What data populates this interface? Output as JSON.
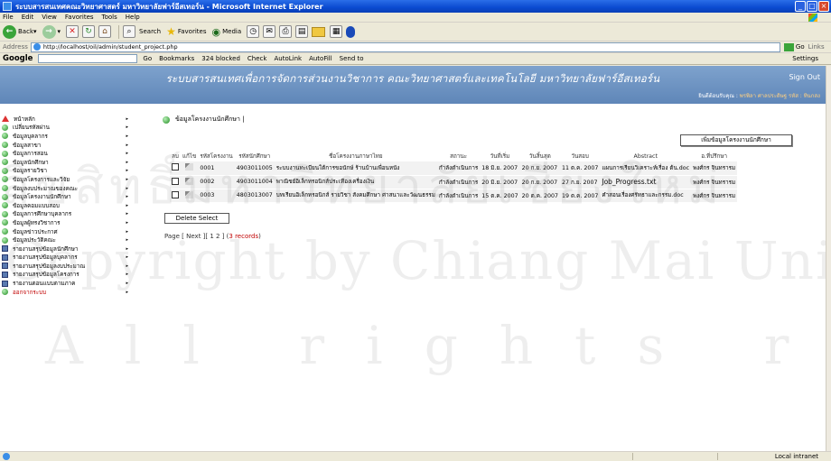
{
  "window": {
    "title": "ระบบสารสนเทศคณะวิทยาศาสตร์ มหาวิทยาลัยฟาร์อีสเทอร์น - Microsoft Internet Explorer"
  },
  "menu": [
    "File",
    "Edit",
    "View",
    "Favorites",
    "Tools",
    "Help"
  ],
  "toolbar": {
    "back": "Back",
    "search": "Search",
    "favorites": "Favorites",
    "media": "Media"
  },
  "address": {
    "label": "Address",
    "url": "http://localhost/oil/admin/student_project.php",
    "go": "Go",
    "links": "Links"
  },
  "googlebar": {
    "logo": "Google",
    "go": "Go",
    "bookmarks": "Bookmarks",
    "blocked": "324 blocked",
    "check": "Check",
    "autolink": "AutoLink",
    "autofill": "AutoFill",
    "sendto": "Send to",
    "settings": "Settings"
  },
  "header": {
    "title": "ระบบสารสนเทศเพื่อการจัดการส่วนงานวิชาการ คณะวิทยาศาสตร์และเทคโนโลยี มหาวิทยาลัยฟาร์อีสเทอร์น",
    "signout": "Sign Out",
    "welcome_prefix": "ยินดีต้อนรับคุณ :",
    "welcome_user": "พรพิลา ศาลประดิษฐ รหัส : ทินกสง"
  },
  "sidebar": {
    "items": [
      {
        "label": "หน้าหลัก",
        "icon": "home"
      },
      {
        "label": "เปลี่ยนรหัสผ่าน",
        "icon": "dot"
      },
      {
        "label": "ข้อมูลบุคลากร",
        "icon": "dot"
      },
      {
        "label": "ข้อมูลสาขา",
        "icon": "dot"
      },
      {
        "label": "ข้อมูลการสอน",
        "icon": "dot"
      },
      {
        "label": "ข้อมูลนักศึกษา",
        "icon": "dot"
      },
      {
        "label": "ข้อมูลรายวิชา",
        "icon": "dot"
      },
      {
        "label": "ข้อมูลโครงการและวิจัย",
        "icon": "dot"
      },
      {
        "label": "ข้อมูลงบประมาณของคณะ",
        "icon": "dot"
      },
      {
        "label": "ข้อมูลโครงงานนักศึกษา",
        "icon": "dot"
      },
      {
        "label": "ข้อมูลคอมแบบสอบ",
        "icon": "dot"
      },
      {
        "label": "ข้อมูลการศึกษาบุคลากร",
        "icon": "dot"
      },
      {
        "label": "ข้อมูลผู้ทรงวิชาการ",
        "icon": "dot"
      },
      {
        "label": "ข้อมูลข่าวประกาศ",
        "icon": "dot"
      },
      {
        "label": "ข้อมูลประวัติคณะ",
        "icon": "dot"
      },
      {
        "label": "รายงานสรุปข้อมูลนักศึกษา",
        "icon": "book"
      },
      {
        "label": "รายงานสรุปข้อมูลบุคลากร",
        "icon": "book"
      },
      {
        "label": "รายงานสรุปข้อมูลงบประมาณ",
        "icon": "book"
      },
      {
        "label": "รายงานสรุปข้อมูลโครงการ",
        "icon": "book"
      },
      {
        "label": "รายงานตอนแบบตามภาค",
        "icon": "book"
      },
      {
        "label": "ออกจากระบบ",
        "icon": "dot",
        "red": true
      }
    ]
  },
  "main": {
    "title": "ข้อมูลโครงงานนักศึกษา |",
    "add_button": "เพิ่มข้อมูลโครงงานนักศึกษา",
    "columns": [
      "ลบ",
      "แก้ไข",
      "รหัสโครงงาน",
      "รหัสนักศึกษา",
      "ชื่อโครงงานภาษาไทย",
      "สถานะ",
      "วันที่เริ่ม",
      "วันสิ้นสุด",
      "วันสอบ",
      "Abstract",
      "อ.ที่ปรึกษา"
    ],
    "rows": [
      {
        "code": "0001",
        "student": "4903011005",
        "title": "ระบบงานทะเบียนใต้การขอนักษ์ ร้านบ้านเพื่อนหนัง",
        "status": "กำลังดำเนินการ",
        "start": "18 มิ.ย. 2007",
        "end": "20 ก.ย. 2007",
        "exam": "11 ต.ค. 2007",
        "abstract": "แผนการเรียนวิเคราะห์เรื่อง ต้น.doc",
        "advisor": "พงศ์กร จินทรารม"
      },
      {
        "code": "0002",
        "student": "4903011004",
        "title": "พาณิชย์อิเล็กทรอนิกส์ประเทืองเครื่องเงิน",
        "status": "กำลังดำเนินการ",
        "start": "20 มิ.ย. 2007",
        "end": "20 ก.ย. 2007",
        "exam": "27 ก.ย. 2007",
        "abstract": "Job_Progress.txt",
        "advisor": "พงศ์กร จินทรารม"
      },
      {
        "code": "0003",
        "student": "4803013007",
        "title": "บทเรียนอิเล็กทรอนิกส์ รายวิชา สังคมศึกษา ศาสนาและวัฒนธรรม",
        "status": "กำลังดำเนินการ",
        "start": "15 ต.ค. 2007",
        "end": "20 ต.ค. 2007",
        "exam": "19 ต.ค. 2007",
        "abstract": "คำสอนเรื่องศรัทธาและกรรม.doc",
        "advisor": "พงศ์กร จินทรารม"
      }
    ],
    "delete_button": "Delete Select",
    "pager_text": "Page [ Next ][ 1 2 ] (",
    "pager_count": "3 records",
    "pager_end": ")"
  },
  "watermark": {
    "line1": "ลิขสิทธิ์มหาวิทยาลัยเชียงใหม่",
    "line2": "Copyright by Chiang Mai University",
    "line3": "All rights reserved"
  },
  "status": {
    "zone": "Local intranet"
  }
}
